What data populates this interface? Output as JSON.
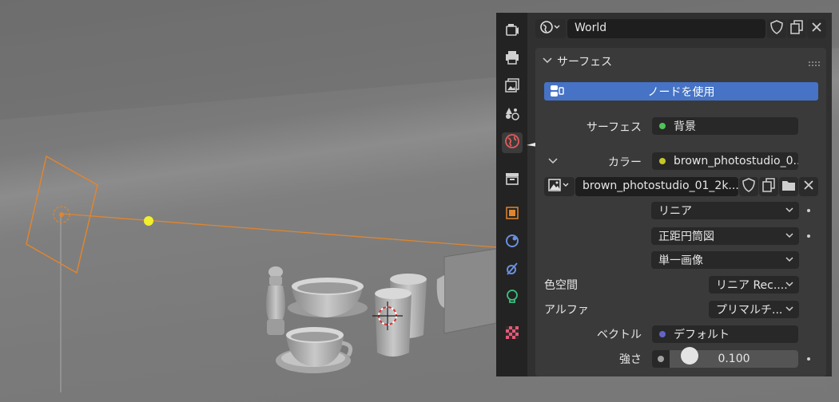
{
  "colors": {
    "panel_bg": "#303030",
    "tab_bg": "#232323",
    "accent_blue": "#4673c5",
    "selected_orange": "#e0852f",
    "light_yellow": "#f2ef2c",
    "socket_green": "#4fc25a",
    "socket_yellow": "#c7c729",
    "socket_purple": "#6363c7",
    "socket_gray": "#a1a1a1"
  },
  "tabs": [
    {
      "icon": "render-camera-icon"
    },
    {
      "icon": "output-printer-icon"
    },
    {
      "icon": "view-layer-icon"
    },
    {
      "icon": "scene-icon"
    },
    {
      "icon": "world-icon",
      "active": true
    },
    {
      "icon": "collection-icon"
    },
    {
      "icon": "object-icon"
    },
    {
      "icon": "modifier-icon"
    },
    {
      "icon": "particles-icon"
    },
    {
      "icon": "physics-icon"
    },
    {
      "icon": "texture-checker-icon"
    }
  ],
  "header": {
    "world_name": "World"
  },
  "surface_panel": {
    "title": "サーフェス",
    "use_nodes_label": "ノードを使用",
    "surface_label": "サーフェス",
    "surface_value": "背景",
    "color_label": "カラー",
    "color_value": "brown_photostudio_0...",
    "image_name": "brown_photostudio_01_2k...",
    "interpolation": "リニア",
    "projection": "正距円筒図",
    "source": "単一画像",
    "colorspace_label": "色空間",
    "colorspace_value": "リニア Rec....",
    "alpha_label": "アルファ",
    "alpha_value": "プリマルチ...",
    "vector_label": "ベクトル",
    "vector_value": "デフォルト",
    "strength_label": "強さ",
    "strength_value": "0.100"
  }
}
